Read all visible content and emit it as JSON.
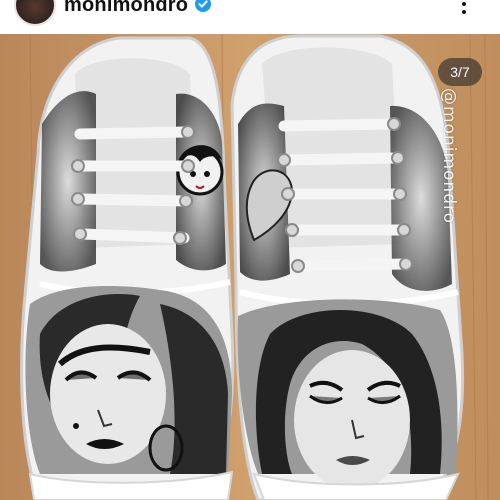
{
  "post": {
    "username": "monimondro",
    "verified": true,
    "avatar_icon": "profile-avatar",
    "menu_icon": "more-options-icon"
  },
  "carousel": {
    "counter": "3/7"
  },
  "photo": {
    "watermark": "@monimondro",
    "subject": "hand-painted white canvas sneakers",
    "colors": {
      "wood": "#c79a65",
      "canvas": "#eeeeee",
      "paint_dark": "#1b1b1b",
      "paint_mid": "#8d8d8d"
    }
  }
}
